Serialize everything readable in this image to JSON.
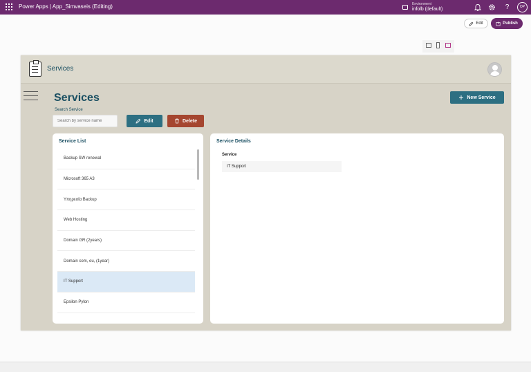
{
  "topbar": {
    "app_title": "Power Apps  |  App_Simvaseis (Editing)",
    "environment_label": "Environment",
    "environment_name": "infolb (default)",
    "profile_initials": "OP"
  },
  "toolbar": {
    "edit_label": "Edit",
    "publish_label": "Publish"
  },
  "app": {
    "header_title": "Services",
    "page_title": "Services",
    "search_label": "Search Service",
    "search_placeholder": "Search by service name",
    "edit_button_label": "Edit",
    "delete_button_label": "Delete",
    "new_service_label": "New Service"
  },
  "service_list": {
    "title": "Service List",
    "items": [
      {
        "label": "Backup SW renewal"
      },
      {
        "label": "Microsoft 365 A3"
      },
      {
        "label": "Υπηρεσία Backup"
      },
      {
        "label": "Web Hosting"
      },
      {
        "label": "Domain GR (2years)"
      },
      {
        "label": "Domain com, eu, (1year)"
      },
      {
        "label": "IT Support"
      },
      {
        "label": "Epsilon Pylon"
      }
    ]
  },
  "service_details": {
    "title": "Service Details",
    "field_label": "Service",
    "field_value": "IT Support"
  }
}
